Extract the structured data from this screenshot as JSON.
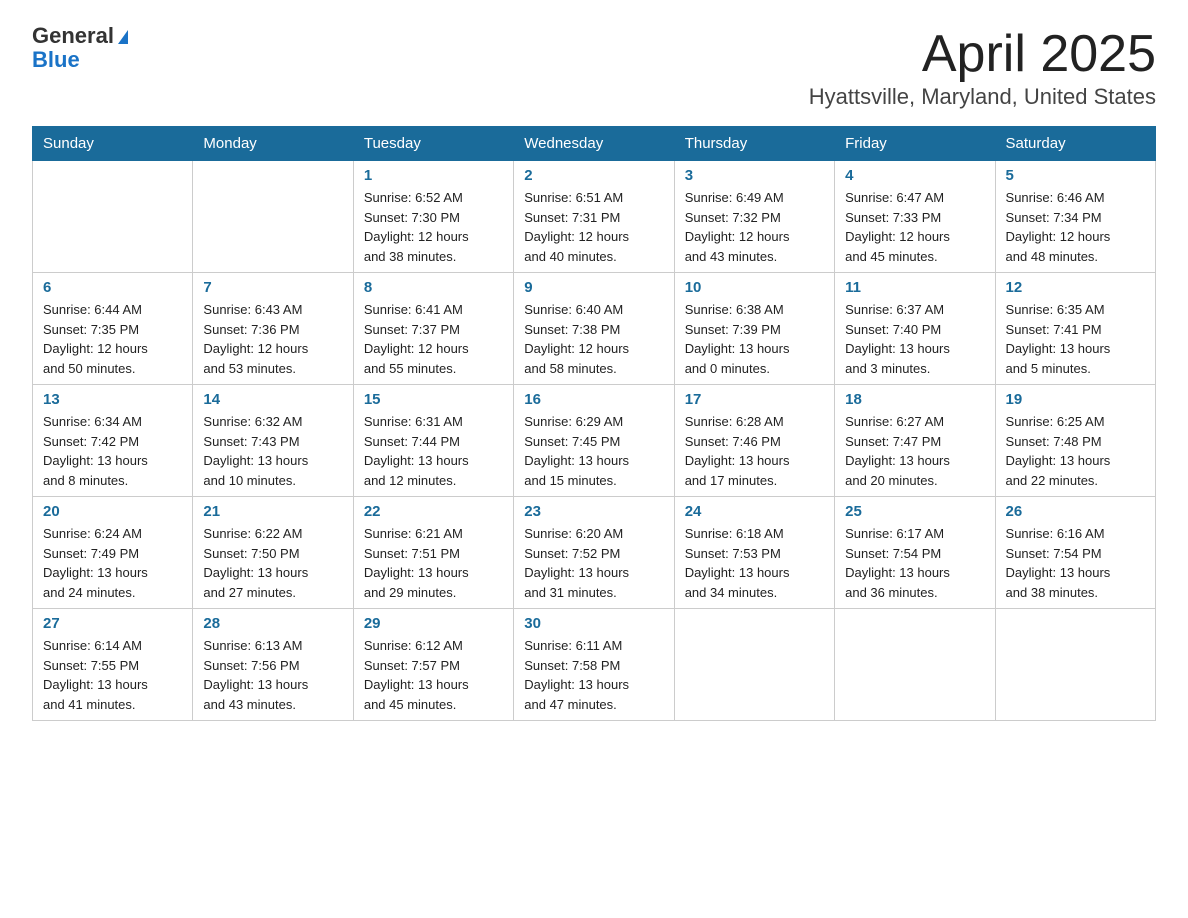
{
  "header": {
    "logo_general": "General",
    "logo_blue": "Blue",
    "title": "April 2025",
    "subtitle": "Hyattsville, Maryland, United States"
  },
  "days_of_week": [
    "Sunday",
    "Monday",
    "Tuesday",
    "Wednesday",
    "Thursday",
    "Friday",
    "Saturday"
  ],
  "weeks": [
    [
      {
        "day": "",
        "info": ""
      },
      {
        "day": "",
        "info": ""
      },
      {
        "day": "1",
        "info": "Sunrise: 6:52 AM\nSunset: 7:30 PM\nDaylight: 12 hours\nand 38 minutes."
      },
      {
        "day": "2",
        "info": "Sunrise: 6:51 AM\nSunset: 7:31 PM\nDaylight: 12 hours\nand 40 minutes."
      },
      {
        "day": "3",
        "info": "Sunrise: 6:49 AM\nSunset: 7:32 PM\nDaylight: 12 hours\nand 43 minutes."
      },
      {
        "day": "4",
        "info": "Sunrise: 6:47 AM\nSunset: 7:33 PM\nDaylight: 12 hours\nand 45 minutes."
      },
      {
        "day": "5",
        "info": "Sunrise: 6:46 AM\nSunset: 7:34 PM\nDaylight: 12 hours\nand 48 minutes."
      }
    ],
    [
      {
        "day": "6",
        "info": "Sunrise: 6:44 AM\nSunset: 7:35 PM\nDaylight: 12 hours\nand 50 minutes."
      },
      {
        "day": "7",
        "info": "Sunrise: 6:43 AM\nSunset: 7:36 PM\nDaylight: 12 hours\nand 53 minutes."
      },
      {
        "day": "8",
        "info": "Sunrise: 6:41 AM\nSunset: 7:37 PM\nDaylight: 12 hours\nand 55 minutes."
      },
      {
        "day": "9",
        "info": "Sunrise: 6:40 AM\nSunset: 7:38 PM\nDaylight: 12 hours\nand 58 minutes."
      },
      {
        "day": "10",
        "info": "Sunrise: 6:38 AM\nSunset: 7:39 PM\nDaylight: 13 hours\nand 0 minutes."
      },
      {
        "day": "11",
        "info": "Sunrise: 6:37 AM\nSunset: 7:40 PM\nDaylight: 13 hours\nand 3 minutes."
      },
      {
        "day": "12",
        "info": "Sunrise: 6:35 AM\nSunset: 7:41 PM\nDaylight: 13 hours\nand 5 minutes."
      }
    ],
    [
      {
        "day": "13",
        "info": "Sunrise: 6:34 AM\nSunset: 7:42 PM\nDaylight: 13 hours\nand 8 minutes."
      },
      {
        "day": "14",
        "info": "Sunrise: 6:32 AM\nSunset: 7:43 PM\nDaylight: 13 hours\nand 10 minutes."
      },
      {
        "day": "15",
        "info": "Sunrise: 6:31 AM\nSunset: 7:44 PM\nDaylight: 13 hours\nand 12 minutes."
      },
      {
        "day": "16",
        "info": "Sunrise: 6:29 AM\nSunset: 7:45 PM\nDaylight: 13 hours\nand 15 minutes."
      },
      {
        "day": "17",
        "info": "Sunrise: 6:28 AM\nSunset: 7:46 PM\nDaylight: 13 hours\nand 17 minutes."
      },
      {
        "day": "18",
        "info": "Sunrise: 6:27 AM\nSunset: 7:47 PM\nDaylight: 13 hours\nand 20 minutes."
      },
      {
        "day": "19",
        "info": "Sunrise: 6:25 AM\nSunset: 7:48 PM\nDaylight: 13 hours\nand 22 minutes."
      }
    ],
    [
      {
        "day": "20",
        "info": "Sunrise: 6:24 AM\nSunset: 7:49 PM\nDaylight: 13 hours\nand 24 minutes."
      },
      {
        "day": "21",
        "info": "Sunrise: 6:22 AM\nSunset: 7:50 PM\nDaylight: 13 hours\nand 27 minutes."
      },
      {
        "day": "22",
        "info": "Sunrise: 6:21 AM\nSunset: 7:51 PM\nDaylight: 13 hours\nand 29 minutes."
      },
      {
        "day": "23",
        "info": "Sunrise: 6:20 AM\nSunset: 7:52 PM\nDaylight: 13 hours\nand 31 minutes."
      },
      {
        "day": "24",
        "info": "Sunrise: 6:18 AM\nSunset: 7:53 PM\nDaylight: 13 hours\nand 34 minutes."
      },
      {
        "day": "25",
        "info": "Sunrise: 6:17 AM\nSunset: 7:54 PM\nDaylight: 13 hours\nand 36 minutes."
      },
      {
        "day": "26",
        "info": "Sunrise: 6:16 AM\nSunset: 7:54 PM\nDaylight: 13 hours\nand 38 minutes."
      }
    ],
    [
      {
        "day": "27",
        "info": "Sunrise: 6:14 AM\nSunset: 7:55 PM\nDaylight: 13 hours\nand 41 minutes."
      },
      {
        "day": "28",
        "info": "Sunrise: 6:13 AM\nSunset: 7:56 PM\nDaylight: 13 hours\nand 43 minutes."
      },
      {
        "day": "29",
        "info": "Sunrise: 6:12 AM\nSunset: 7:57 PM\nDaylight: 13 hours\nand 45 minutes."
      },
      {
        "day": "30",
        "info": "Sunrise: 6:11 AM\nSunset: 7:58 PM\nDaylight: 13 hours\nand 47 minutes."
      },
      {
        "day": "",
        "info": ""
      },
      {
        "day": "",
        "info": ""
      },
      {
        "day": "",
        "info": ""
      }
    ]
  ]
}
